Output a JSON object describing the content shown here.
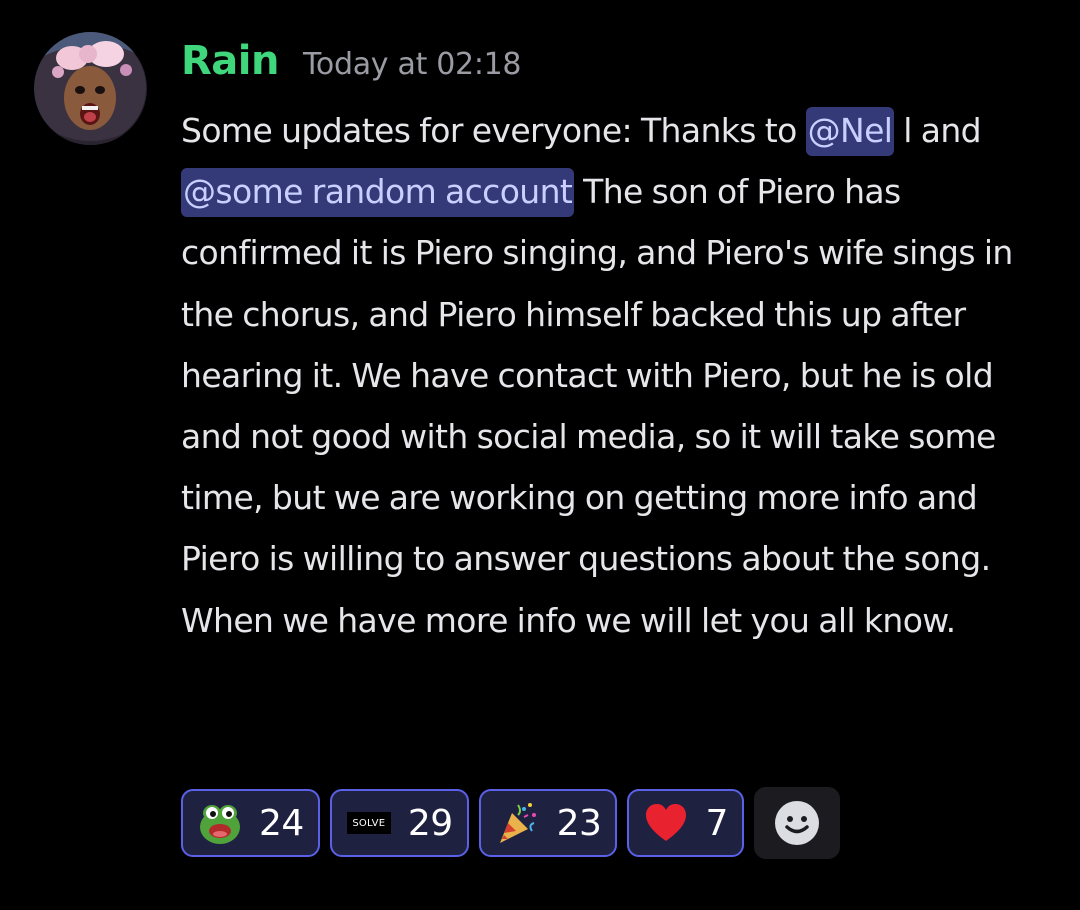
{
  "message": {
    "author": "Rain",
    "timestamp": "Today at 02:18",
    "text_part1": "Some updates for everyone: Thanks to ",
    "mention1": "@Nel",
    "text_part2": " l and ",
    "mention2": "@some random account",
    "text_part3": "  The son of Piero has confirmed it is Piero singing, and Piero's wife sings in the chorus, and Piero himself backed this up after hearing it. We have contact with Piero, but he is old and not good with social media, so it will take some time, but we are working on getting more info and Piero is willing to answer questions about the song. When we have more info we will let you all know."
  },
  "reactions": [
    {
      "icon": "pepe-frog-emoji",
      "count": "24"
    },
    {
      "icon": "solve-badge-emoji",
      "label": "SOLVE",
      "count": "29"
    },
    {
      "icon": "party-popper-emoji",
      "count": "23"
    },
    {
      "icon": "red-heart-emoji",
      "count": "7"
    }
  ],
  "colors": {
    "username": "#3fd67c",
    "mention_bg": "#343a78",
    "reaction_border": "#5a61e6",
    "background": "#000000"
  }
}
